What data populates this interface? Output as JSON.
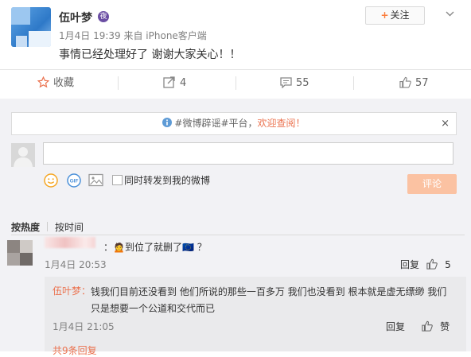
{
  "post": {
    "username": "伍叶梦",
    "vip_badge": "夜",
    "follow_label": "关注",
    "follow_plus": "+",
    "meta": "1月4日 19:39 来自 iPhone客户端",
    "text": "事情已经处理好了 谢谢大家关心！！"
  },
  "actions": {
    "favorite_label": "收藏",
    "repost_count": "4",
    "comment_count": "55",
    "like_count": "57"
  },
  "notice": {
    "prefix": "#微博辟谣#平台，",
    "highlight": "欢迎查阅！",
    "close": "×"
  },
  "composer": {
    "input_placeholder": "",
    "forward_label": "同时转发到我的微博",
    "submit_label": "评论"
  },
  "sort": {
    "hot": "按热度",
    "time": "按时间"
  },
  "comments": [
    {
      "text": "：🙍到位了就删了🇪🇺 ？",
      "time": "1月4日 20:53",
      "reply_label": "回复",
      "like_count": "5"
    }
  ],
  "nested_reply": {
    "name": "伍叶梦：",
    "text": "钱我们目前还没看到 他们所说的那些一百多万 我们也没看到 根本就是虚无缥缈 我们只是想要一个公道和交代而已",
    "time": "1月4日 21:05",
    "reply_label": "回复",
    "like_label": "赞"
  },
  "more_replies": "共9条回复",
  "colors": {
    "accent": "#eb7350",
    "submit_disabled": "#fbc2a2",
    "panel_bg": "#f2f2f5"
  }
}
